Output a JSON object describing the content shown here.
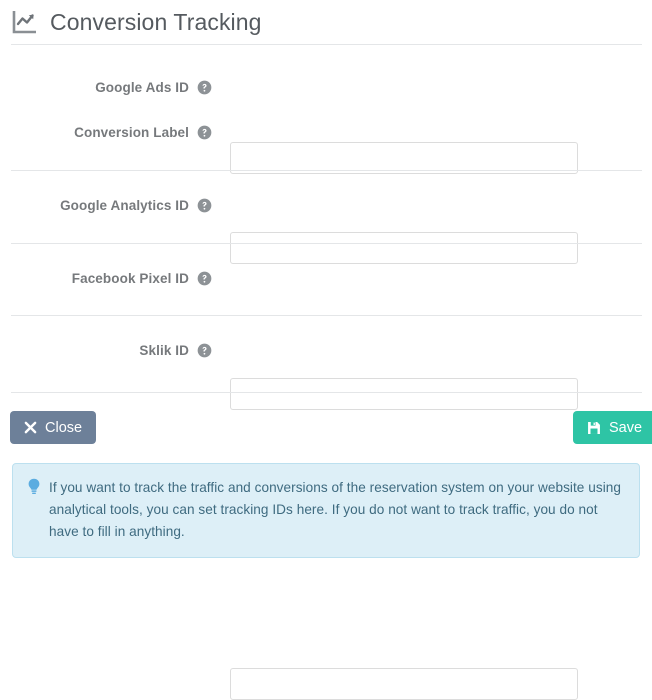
{
  "header": {
    "title": "Conversion Tracking",
    "icon": "line-chart-icon"
  },
  "form": {
    "fields": [
      {
        "label": "Google Ads ID",
        "value": "",
        "placeholder": "",
        "help_icon": "help-circle-icon"
      },
      {
        "label": "Conversion Label",
        "value": "",
        "placeholder": "",
        "help_icon": "help-circle-icon"
      },
      {
        "label": "Google Analytics ID",
        "value": "",
        "placeholder": "",
        "help_icon": "help-circle-icon"
      },
      {
        "label": "Facebook Pixel ID",
        "value": "",
        "placeholder": "",
        "help_icon": "help-circle-icon"
      },
      {
        "label": "Sklik ID",
        "value": "",
        "placeholder": "",
        "help_icon": "help-circle-icon"
      }
    ]
  },
  "footer": {
    "close_label": "Close",
    "close_icon": "close-x-icon",
    "close_color": "#6d8099",
    "save_label": "Save",
    "save_icon": "floppy-save-icon",
    "save_color": "#2ec4a5"
  },
  "alert": {
    "icon": "lightbulb-icon",
    "text": "If you want to track the traffic and conversions of the reservation system on your website using analytical tools, you can set tracking IDs here. If you do not want to track traffic, you do not have to fill in anything.",
    "background": "#ddeff7",
    "border": "#bce0ef",
    "text_color": "#3f6b80"
  }
}
